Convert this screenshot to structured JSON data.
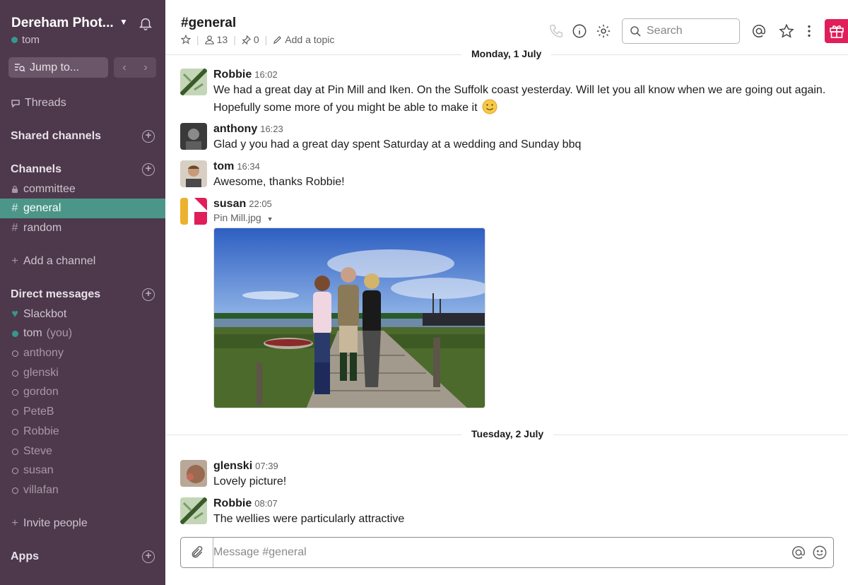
{
  "workspace": {
    "name": "Dereham Phot...",
    "user": "tom"
  },
  "sidebar": {
    "jump_label": "Jump to...",
    "threads": "Threads",
    "shared_channels": "Shared channels",
    "channels_heading": "Channels",
    "channels": [
      {
        "name": "committee",
        "type": "private"
      },
      {
        "name": "general",
        "type": "public",
        "active": true
      },
      {
        "name": "random",
        "type": "public"
      }
    ],
    "add_channel": "Add a channel",
    "dm_heading": "Direct messages",
    "direct_messages": [
      {
        "name": "Slackbot",
        "status": "bot"
      },
      {
        "name": "tom",
        "suffix": "(you)",
        "status": "online"
      },
      {
        "name": "anthony",
        "status": "away"
      },
      {
        "name": "glenski",
        "status": "away"
      },
      {
        "name": "gordon",
        "status": "away"
      },
      {
        "name": "PeteB",
        "status": "away"
      },
      {
        "name": "Robbie",
        "status": "away"
      },
      {
        "name": "Steve",
        "status": "away"
      },
      {
        "name": "susan",
        "status": "away"
      },
      {
        "name": "villafan",
        "status": "away"
      }
    ],
    "invite": "Invite people",
    "apps": "Apps"
  },
  "channel_header": {
    "title": "#general",
    "members": "13",
    "pins": "0",
    "topic": "Add a topic",
    "search_placeholder": "Search"
  },
  "days": [
    {
      "label": "Monday, 1 July"
    },
    {
      "label": "Tuesday, 2 July"
    }
  ],
  "messages": [
    {
      "author": "Robbie",
      "time": "16:02",
      "text": "We had a great day at Pin Mill and Iken. On the Suffolk coast yesterday. Will let you all know when we are going out again. Hopefully some more of you might be able to make it"
    },
    {
      "author": "anthony",
      "time": "16:23",
      "text": "Glad y you had a great day spent Saturday at a wedding and Sunday bbq"
    },
    {
      "author": "tom",
      "time": "16:34",
      "text": "Awesome, thanks Robbie!"
    },
    {
      "author": "susan",
      "time": "22:05",
      "file": "Pin Mill.jpg"
    },
    {
      "author": "glenski",
      "time": "07:39",
      "text": "Lovely picture!"
    },
    {
      "author": "Robbie",
      "time": "08:07",
      "text": "The wellies were particularly attractive"
    }
  ],
  "composer": {
    "placeholder": "Message #general"
  },
  "colors": {
    "sidebar": "#4d394b",
    "active": "#4c9689",
    "online": "#38978d",
    "gift": "#e01e5a"
  }
}
